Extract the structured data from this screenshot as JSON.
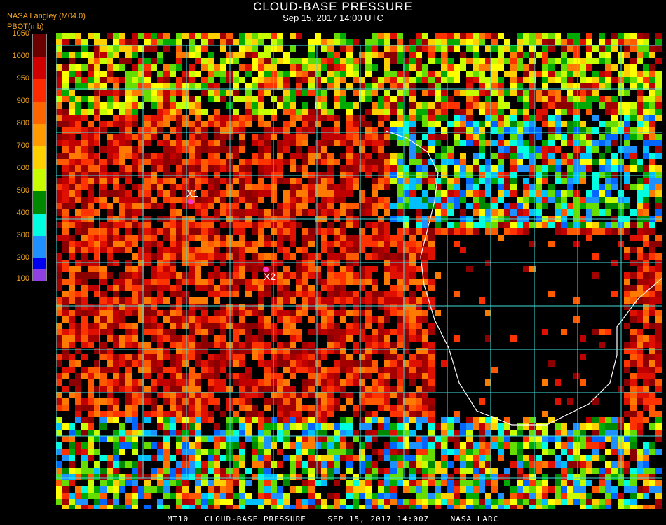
{
  "header": {
    "title": "CLOUD-BASE PRESSURE",
    "subtitle": "Sep 15, 2017 14:00 UTC",
    "org": "NASA Langley (M04.0)",
    "unit": "PBOT(mb)"
  },
  "colorbar": {
    "ticks": [
      "1050",
      "1000",
      "950",
      "900",
      "850",
      "800",
      "750",
      "700",
      "650",
      "600",
      "550",
      "500",
      "450",
      "400",
      "350",
      "300",
      "250",
      "200",
      "150",
      "100"
    ],
    "shown_ticks": [
      "1050",
      "1000",
      "950",
      "900",
      "800",
      "700",
      "600",
      "500",
      "400",
      "300",
      "200",
      "100"
    ],
    "colors": [
      "#6b0000",
      "#d00000",
      "#ff2000",
      "#ff6000",
      "#ff9a00",
      "#ffd000",
      "#ffff00",
      "#c8ff00",
      "#66dd00",
      "#008800",
      "#00ffe0",
      "#00bfff",
      "#0066ff",
      "#0000ee",
      "#9040e0"
    ]
  },
  "markers": [
    {
      "id": "X1",
      "label": "X1",
      "color": "#ff33cc"
    },
    {
      "id": "X2",
      "label": "X2",
      "color": "#ff33cc"
    }
  ],
  "footer": {
    "text": "MT10   CLOUD-BASE PRESSURE    SEP 15, 2017 14:00Z    NASA LARC"
  },
  "map": {
    "grid_color": "#40e0e0",
    "land_outline_color": "#ffffff",
    "background": "#000000",
    "grid_labels_color": "#a00000"
  }
}
